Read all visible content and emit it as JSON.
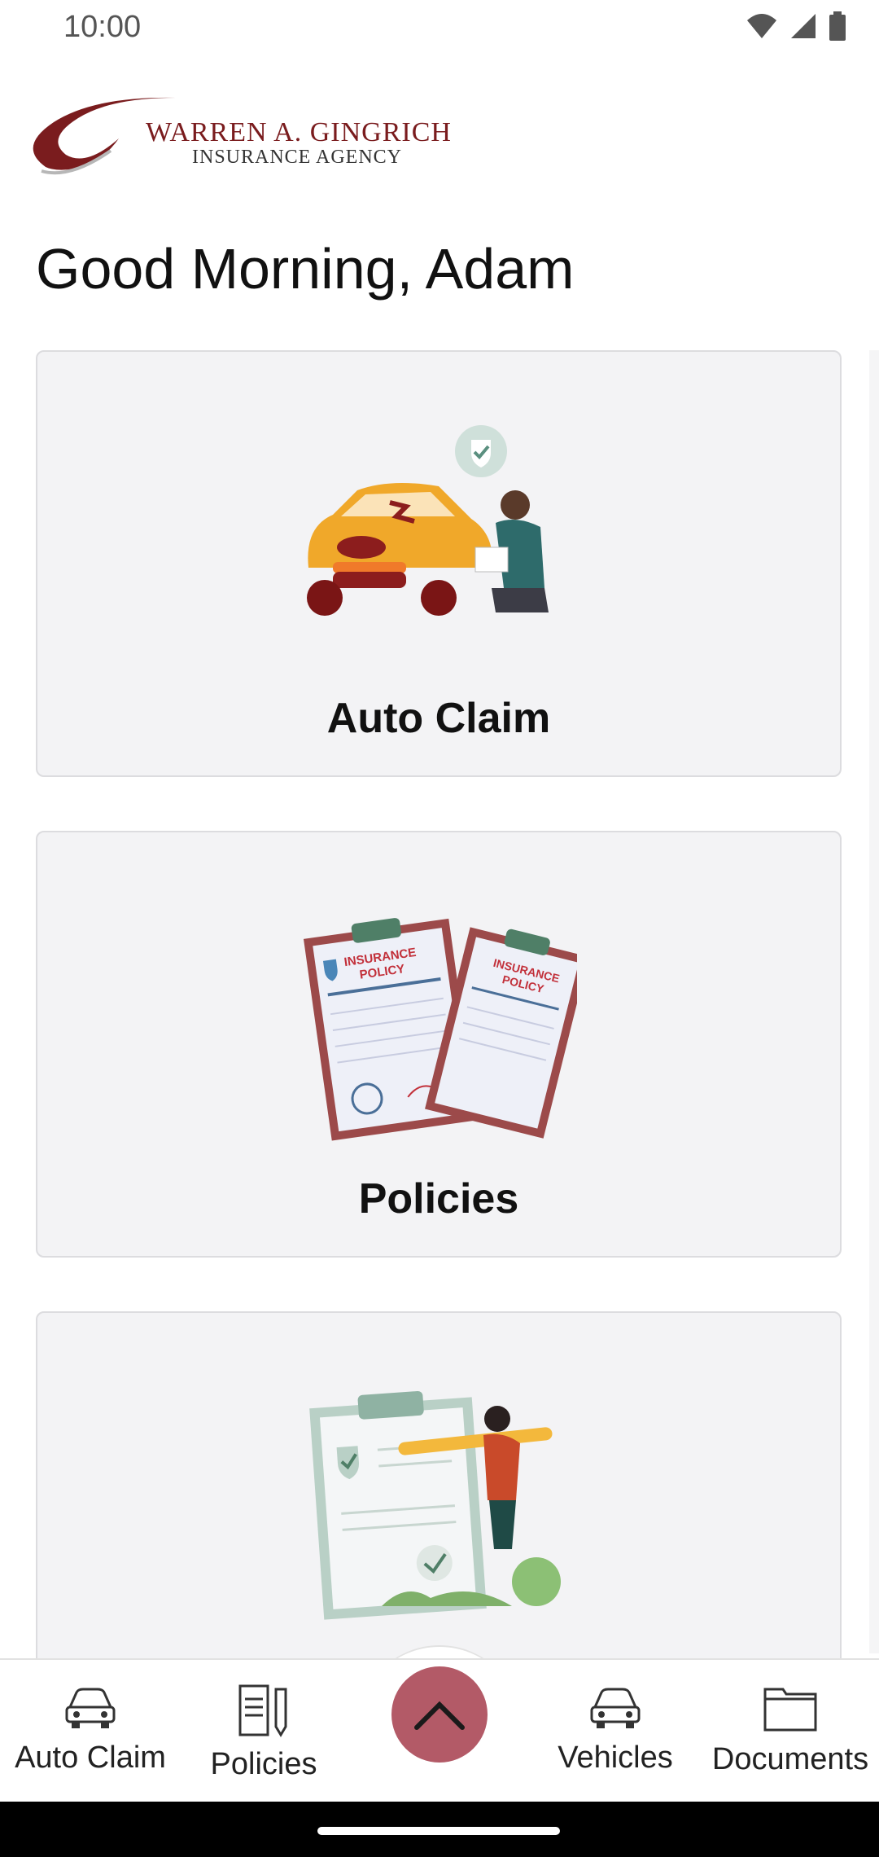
{
  "status_bar": {
    "time": "10:00",
    "icons": [
      "wifi-icon",
      "signal-icon",
      "battery-icon"
    ]
  },
  "logo": {
    "name": "WARREN A. GINGRICH",
    "subtitle": "INSURANCE AGENCY",
    "brand_color": "#7a1c1e"
  },
  "greeting": "Good Morning, Adam",
  "cards": [
    {
      "label": "Auto Claim",
      "icon": "car-damage-illustration"
    },
    {
      "label": "Policies",
      "icon": "insurance-policy-illustration"
    },
    {
      "label": "",
      "icon": "checklist-illustration"
    }
  ],
  "illustrations": {
    "policy_doc_text": "INSURANCE\nPOLICY"
  },
  "bottom_nav": {
    "items": [
      {
        "label": "Auto Claim",
        "icon": "car-icon"
      },
      {
        "label": "Policies",
        "icon": "document-pen-icon"
      },
      {
        "label": "Vehicles",
        "icon": "car-icon"
      },
      {
        "label": "Documents",
        "icon": "folder-icon"
      }
    ],
    "fab_icon": "chevron-up-icon",
    "fab_color": "#b35a67"
  }
}
